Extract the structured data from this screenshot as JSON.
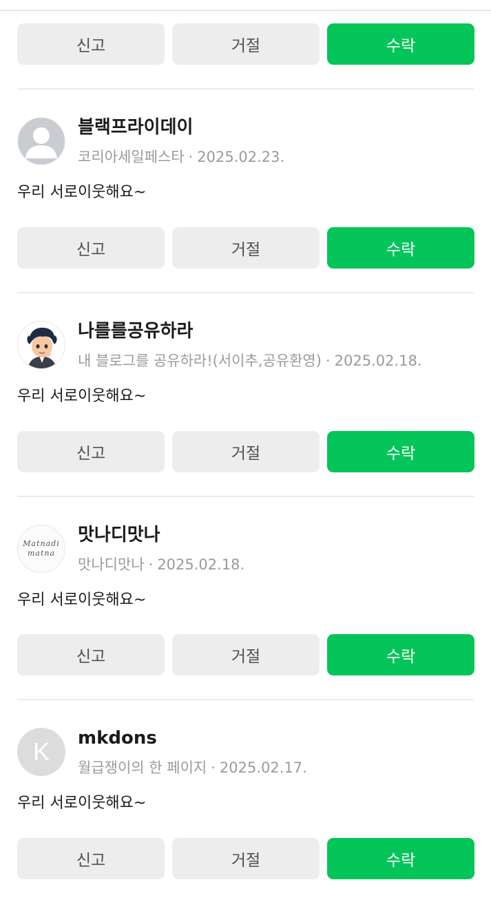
{
  "buttons": {
    "report": "신고",
    "reject": "거절",
    "accept": "수락"
  },
  "colors": {
    "accept": "#04c55a",
    "neutral": "#ededed"
  },
  "requests": [
    {
      "name": "블랙프라이데이",
      "blog": "코리아세일페스타",
      "date": "2025.02.23.",
      "message": "우리 서로이웃해요~",
      "avatar": "default-person-icon"
    },
    {
      "name": "나를를공유하라",
      "blog": "내 블로그를 공유하라!(서이추,공유환영)",
      "date": "2025.02.18.",
      "message": "우리 서로이웃해요~",
      "avatar": "cartoon-character-icon"
    },
    {
      "name": "맛나디맛나",
      "blog": "맛나디맛나",
      "date": "2025.02.18.",
      "message": "우리 서로이웃해요~",
      "avatar": "text-logo",
      "avatar_text": [
        "Matnadi",
        "matna"
      ]
    },
    {
      "name": "mkdons",
      "blog": "월급쟁이의 한 페이지",
      "date": "2025.02.17.",
      "message": "우리 서로이웃해요~",
      "avatar": "letter-avatar",
      "avatar_letter": "K"
    }
  ]
}
